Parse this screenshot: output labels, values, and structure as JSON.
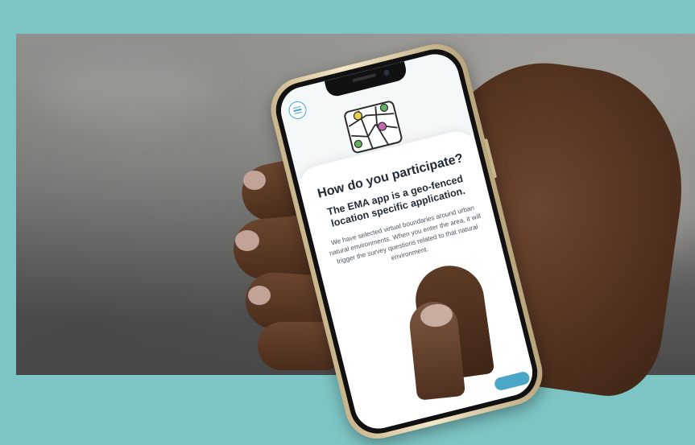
{
  "screen": {
    "title": "How do you participate?",
    "subtitle": "The EMA app is a geo-fenced location specific application.",
    "body": "We have selected virtual boundaries around urban natural environments. When you enter the area, it will trigger the survey questions related to that natural environment."
  },
  "icons": {
    "menu": "hamburger-menu-icon",
    "map": "map-with-pins-icon"
  },
  "colors": {
    "background": "#7cc5c4",
    "accent": "#4ba7c8"
  }
}
